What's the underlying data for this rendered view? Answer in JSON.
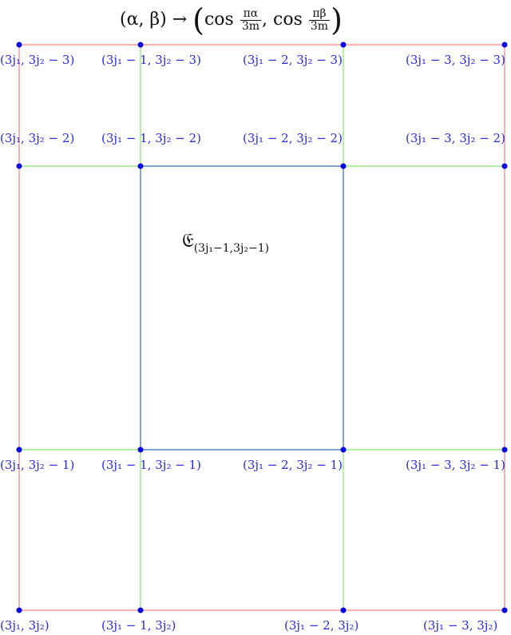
{
  "title": {
    "lhs": "(α, β) →",
    "open_paren": "(",
    "cos1": "cos",
    "frac1_num": "πα",
    "frac1_den": "3m",
    "comma": ",",
    "cos2": "cos",
    "frac2_num": "πβ",
    "frac2_den": "3m",
    "close_paren": ")"
  },
  "colors": {
    "outer_boundary": "#ff9999",
    "inner_grid": "#99ee88",
    "highlight_cell": "#5588cc",
    "vertex": "#0000ee",
    "label": "#2a2ae0"
  },
  "cell_label": {
    "symbol": "𝔈",
    "subscript": "(3j₁−1,3j₂−1)"
  },
  "vertex_labels": [
    {
      "row": "top",
      "col": 0,
      "text": "(3j₁, 3j₂ − 3)"
    },
    {
      "row": "top",
      "col": 1,
      "text": "(3j₁ − 1, 3j₂ − 3)"
    },
    {
      "row": "top",
      "col": 2,
      "text": "(3j₁ − 2, 3j₂ − 3)"
    },
    {
      "row": "top",
      "col": 3,
      "text": "(3j₁ − 3, 3j₂ − 3)"
    },
    {
      "row": "second",
      "col": 0,
      "text": "(3j₁, 3j₂ − 2)"
    },
    {
      "row": "second",
      "col": 1,
      "text": "(3j₁ − 1, 3j₂ − 2)"
    },
    {
      "row": "second",
      "col": 2,
      "text": "(3j₁ − 2, 3j₂ − 2)"
    },
    {
      "row": "second",
      "col": 3,
      "text": "(3j₁ − 3, 3j₂ − 2)"
    },
    {
      "row": "third",
      "col": 0,
      "text": "(3j₁, 3j₂ − 1)"
    },
    {
      "row": "third",
      "col": 1,
      "text": "(3j₁ − 1, 3j₂ − 1)"
    },
    {
      "row": "third",
      "col": 2,
      "text": "(3j₁ − 2, 3j₂ − 1)"
    },
    {
      "row": "third",
      "col": 3,
      "text": "(3j₁ − 3, 3j₂ − 1)"
    },
    {
      "row": "bottom",
      "col": 0,
      "text": "(3j₁, 3j₂)"
    },
    {
      "row": "bottom",
      "col": 1,
      "text": "(3j₁ − 1, 3j₂)"
    },
    {
      "row": "bottom",
      "col": 2,
      "text": "(3j₁ − 2, 3j₂)"
    },
    {
      "row": "bottom",
      "col": 3,
      "text": "(3j₁ − 3, 3j₂)"
    }
  ]
}
